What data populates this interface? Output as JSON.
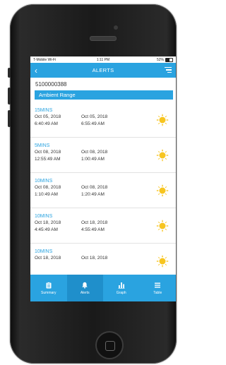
{
  "status_bar": {
    "carrier": "T-Mobile Wi-Fi",
    "time": "1:11 PM",
    "battery": "52%"
  },
  "nav": {
    "title": "ALERTS",
    "back_icon": "chevron-left-icon",
    "menu_icon": "menu-icon"
  },
  "device_id": "5100000388",
  "section_label": "Ambient Range",
  "alerts": [
    {
      "duration": "15MINS",
      "start_date": "Oct 05, 2018",
      "start_time": "6:40:49 AM",
      "end_date": "Oct 05, 2018",
      "end_time": "6:55:49 AM",
      "icon": "sun-icon"
    },
    {
      "duration": "5MINS",
      "start_date": "Oct 08, 2018",
      "start_time": "12:55:49 AM",
      "end_date": "Oct 08, 2018",
      "end_time": "1:00:49 AM",
      "icon": "sun-icon"
    },
    {
      "duration": "10MINS",
      "start_date": "Oct 08, 2018",
      "start_time": "1:10:49 AM",
      "end_date": "Oct 08, 2018",
      "end_time": "1:20:49 AM",
      "icon": "sun-icon"
    },
    {
      "duration": "10MINS",
      "start_date": "Oct 18, 2018",
      "start_time": "4:45:49 AM",
      "end_date": "Oct 18, 2018",
      "end_time": "4:55:49 AM",
      "icon": "sun-icon"
    },
    {
      "duration": "10MINS",
      "start_date": "Oct 18, 2018",
      "start_time": "",
      "end_date": "Oct 18, 2018",
      "end_time": "",
      "icon": "sun-icon"
    }
  ],
  "tabs": [
    {
      "label": "Summary",
      "icon": "clipboard-icon"
    },
    {
      "label": "Alerts",
      "icon": "bell-icon",
      "active": true
    },
    {
      "label": "Graph",
      "icon": "bar-chart-icon"
    },
    {
      "label": "Table",
      "icon": "list-icon"
    }
  ],
  "colors": {
    "accent": "#2aa3e0",
    "active_tab": "#1f8fcb",
    "sun": "#f7c520"
  }
}
